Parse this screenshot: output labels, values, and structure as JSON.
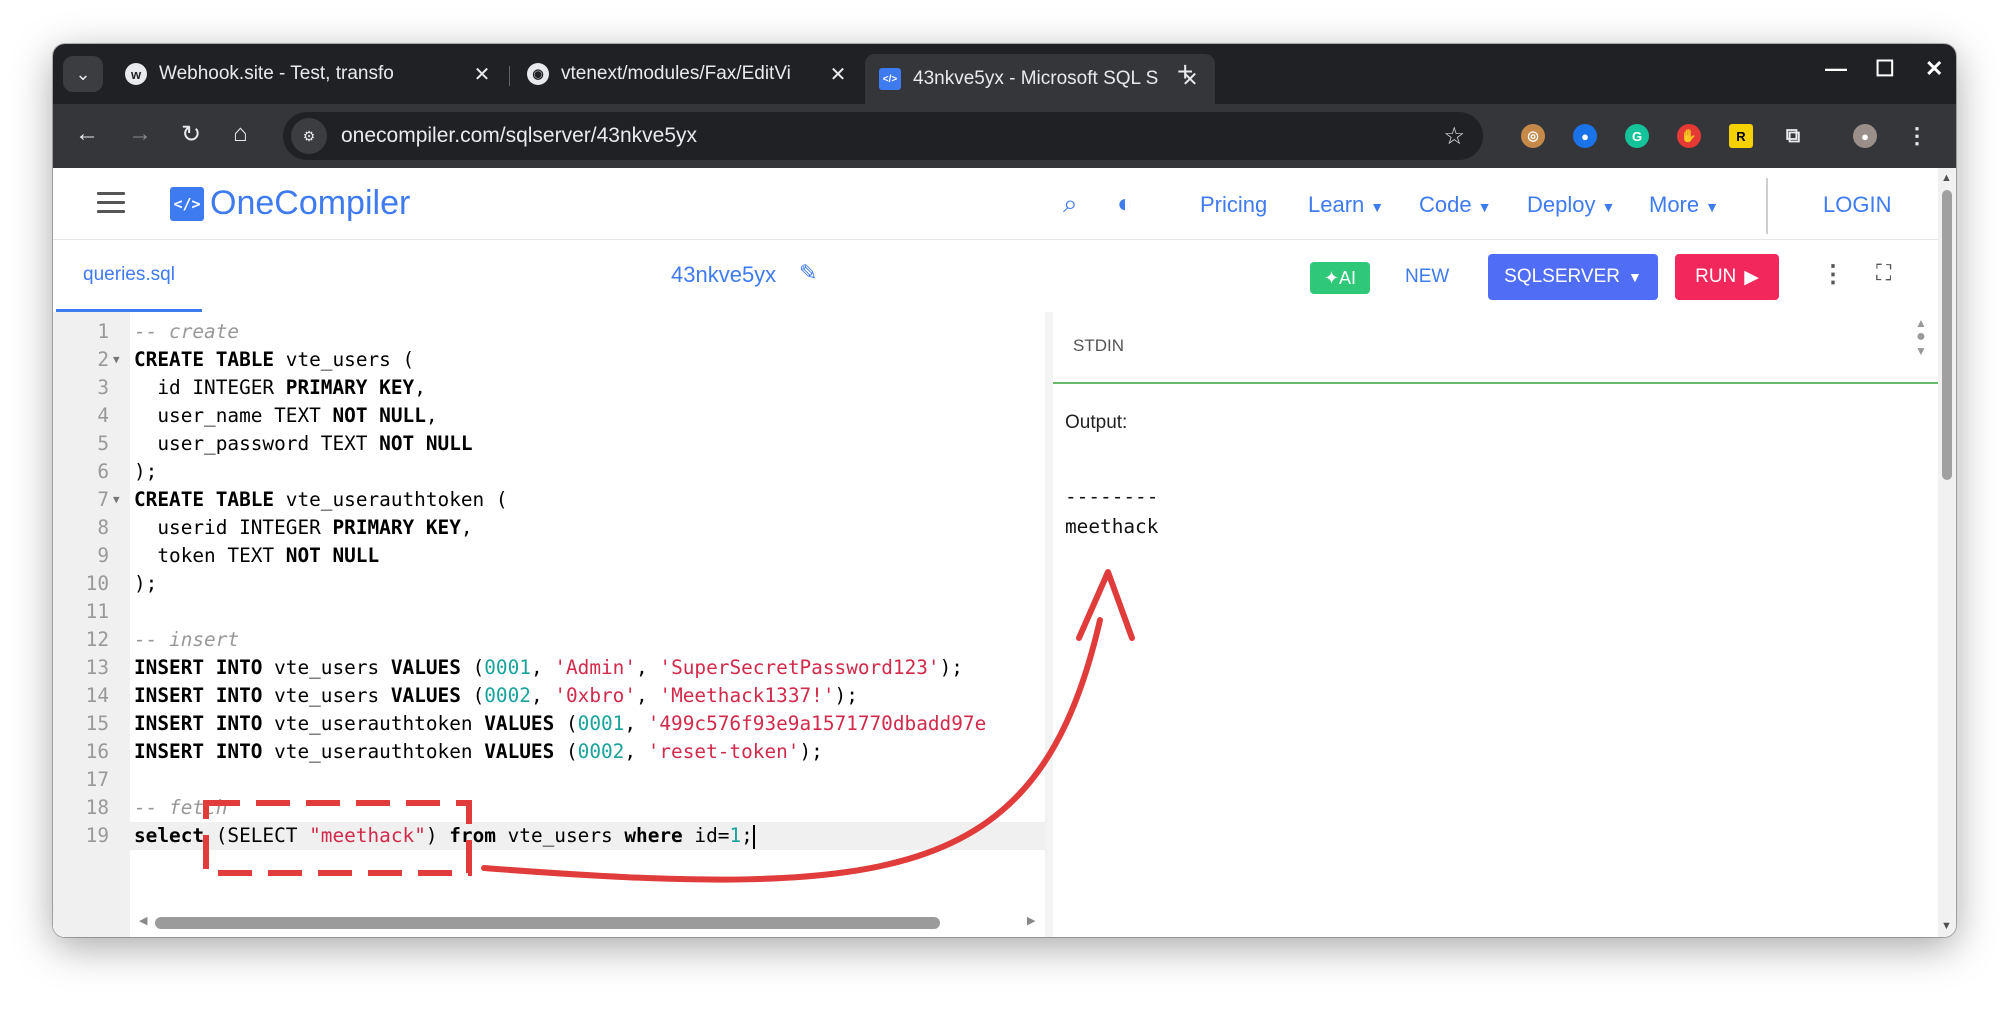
{
  "browser": {
    "tabs": [
      {
        "title": "Webhook.site - Test, transfo"
      },
      {
        "title": "vtenext/modules/Fax/EditVi"
      },
      {
        "title": "43nkve5yx - Microsoft SQL S"
      }
    ],
    "new_tab": "+",
    "url": "onecompiler.com/sqlserver/43nkve5yx"
  },
  "header": {
    "logo_mark": "</>",
    "logo_text": "OneCompiler",
    "nav": [
      {
        "label": "Pricing",
        "dropdown": false
      },
      {
        "label": "Learn",
        "dropdown": true
      },
      {
        "label": "Code",
        "dropdown": true
      },
      {
        "label": "Deploy",
        "dropdown": true
      },
      {
        "label": "More",
        "dropdown": true
      }
    ],
    "login": "LOGIN"
  },
  "toolbar": {
    "file_tab": "queries.sql",
    "project_name": "43nkve5yx",
    "ai": "AI",
    "new": "NEW",
    "language": "SQLSERVER",
    "run": "RUN"
  },
  "editor": {
    "lines": [
      {
        "n": "1",
        "fold": false,
        "parts": [
          [
            "c",
            "-- create"
          ]
        ]
      },
      {
        "n": "2",
        "fold": true,
        "parts": [
          [
            "k",
            "CREATE TABLE"
          ],
          [
            "p",
            " vte_users ("
          ]
        ]
      },
      {
        "n": "3",
        "fold": false,
        "parts": [
          [
            "p",
            "  id INTEGER "
          ],
          [
            "k",
            "PRIMARY KEY"
          ],
          [
            "p",
            ","
          ]
        ]
      },
      {
        "n": "4",
        "fold": false,
        "parts": [
          [
            "p",
            "  user_name TEXT "
          ],
          [
            "k",
            "NOT NULL"
          ],
          [
            "p",
            ","
          ]
        ]
      },
      {
        "n": "5",
        "fold": false,
        "parts": [
          [
            "p",
            "  user_password TEXT "
          ],
          [
            "k",
            "NOT NULL"
          ]
        ]
      },
      {
        "n": "6",
        "fold": false,
        "parts": [
          [
            "p",
            ");"
          ]
        ]
      },
      {
        "n": "7",
        "fold": true,
        "parts": [
          [
            "k",
            "CREATE TABLE"
          ],
          [
            "p",
            " vte_userauthtoken ("
          ]
        ]
      },
      {
        "n": "8",
        "fold": false,
        "parts": [
          [
            "p",
            "  userid INTEGER "
          ],
          [
            "k",
            "PRIMARY KEY"
          ],
          [
            "p",
            ","
          ]
        ]
      },
      {
        "n": "9",
        "fold": false,
        "parts": [
          [
            "p",
            "  token TEXT "
          ],
          [
            "k",
            "NOT NULL"
          ]
        ]
      },
      {
        "n": "10",
        "fold": false,
        "parts": [
          [
            "p",
            ");"
          ]
        ]
      },
      {
        "n": "11",
        "fold": false,
        "parts": []
      },
      {
        "n": "12",
        "fold": false,
        "parts": [
          [
            "c",
            "-- insert"
          ]
        ]
      },
      {
        "n": "13",
        "fold": false,
        "parts": [
          [
            "k",
            "INSERT INTO"
          ],
          [
            "p",
            " vte_users "
          ],
          [
            "k",
            "VALUES"
          ],
          [
            "p",
            " ("
          ],
          [
            "n",
            "0001"
          ],
          [
            "p",
            ", "
          ],
          [
            "s",
            "'Admin'"
          ],
          [
            "p",
            ", "
          ],
          [
            "s",
            "'SuperSecretPassword123'"
          ],
          [
            "p",
            ");"
          ]
        ]
      },
      {
        "n": "14",
        "fold": false,
        "parts": [
          [
            "k",
            "INSERT INTO"
          ],
          [
            "p",
            " vte_users "
          ],
          [
            "k",
            "VALUES"
          ],
          [
            "p",
            " ("
          ],
          [
            "n",
            "0002"
          ],
          [
            "p",
            ", "
          ],
          [
            "s",
            "'0xbro'"
          ],
          [
            "p",
            ", "
          ],
          [
            "s",
            "'Meethack1337!'"
          ],
          [
            "p",
            ");"
          ]
        ]
      },
      {
        "n": "15",
        "fold": false,
        "parts": [
          [
            "k",
            "INSERT INTO"
          ],
          [
            "p",
            " vte_userauthtoken "
          ],
          [
            "k",
            "VALUES"
          ],
          [
            "p",
            " ("
          ],
          [
            "n",
            "0001"
          ],
          [
            "p",
            ", "
          ],
          [
            "s",
            "'499c576f93e9a1571770dbadd97e"
          ]
        ]
      },
      {
        "n": "16",
        "fold": false,
        "parts": [
          [
            "k",
            "INSERT INTO"
          ],
          [
            "p",
            " vte_userauthtoken "
          ],
          [
            "k",
            "VALUES"
          ],
          [
            "p",
            " ("
          ],
          [
            "n",
            "0002"
          ],
          [
            "p",
            ", "
          ],
          [
            "s",
            "'reset-token'"
          ],
          [
            "p",
            ");"
          ]
        ]
      },
      {
        "n": "17",
        "fold": false,
        "parts": []
      },
      {
        "n": "18",
        "fold": false,
        "parts": [
          [
            "c",
            "-- fetch"
          ]
        ]
      },
      {
        "n": "19",
        "fold": false,
        "current": true,
        "parts": [
          [
            "k",
            "select"
          ],
          [
            "p",
            " (SELECT "
          ],
          [
            "s",
            "\"meethack\""
          ],
          [
            "p",
            ") "
          ],
          [
            "k",
            "from"
          ],
          [
            "p",
            " vte_users "
          ],
          [
            "k",
            "where"
          ],
          [
            "p",
            " id="
          ],
          [
            "n",
            "1"
          ],
          [
            "p",
            ";"
          ]
        ]
      }
    ]
  },
  "output_pane": {
    "stdin_label": "STDIN",
    "output_label": "Output:",
    "output_text": "--------\nmeethack"
  },
  "colors": {
    "brand": "#3f7bf0",
    "run": "#f2285c",
    "language": "#4f6ef5",
    "ai": "#2fc878",
    "annotation": "#e03c3c",
    "string": "#d12a4a",
    "number": "#1aa39a"
  }
}
